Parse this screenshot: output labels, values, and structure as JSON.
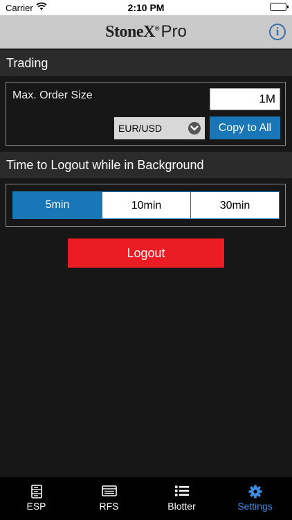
{
  "status_bar": {
    "carrier": "Carrier",
    "time": "2:10 PM"
  },
  "header": {
    "brand": "StoneX",
    "reg_mark": "®",
    "suffix": "Pro",
    "info_icon": "i"
  },
  "trading": {
    "section_title": "Trading",
    "max_order_label": "Max. Order Size",
    "max_order_value": "1M",
    "currency_pair": "EUR/USD",
    "copy_button": "Copy to All"
  },
  "logout_timer": {
    "section_title": "Time to Logout while in Background",
    "options": [
      {
        "label": "5min",
        "selected": true
      },
      {
        "label": "10min",
        "selected": false
      },
      {
        "label": "30min",
        "selected": false
      }
    ]
  },
  "logout_button": "Logout",
  "tabs": [
    {
      "label": "ESP",
      "icon": "server-icon",
      "selected": false
    },
    {
      "label": "RFS",
      "icon": "window-list-icon",
      "selected": false
    },
    {
      "label": "Blotter",
      "icon": "list-icon",
      "selected": false
    },
    {
      "label": "Settings",
      "icon": "gear-icon",
      "selected": true
    }
  ],
  "colors": {
    "accent": "#1a77b7",
    "logout": "#ec1c24",
    "selected_tab": "#3a8ee6",
    "header_bg": "#c9c9c9"
  }
}
